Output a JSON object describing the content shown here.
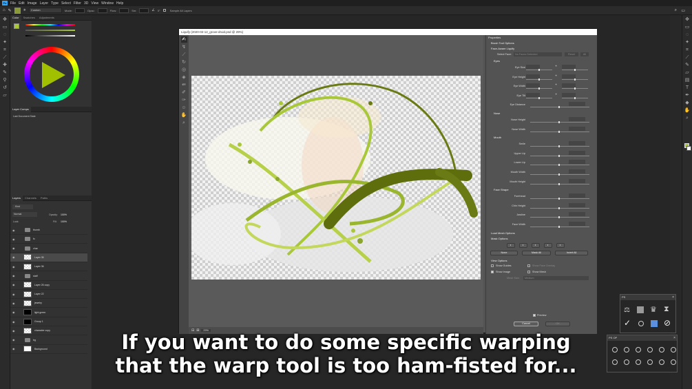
{
  "app": {
    "menu": [
      "File",
      "Edit",
      "Image",
      "Layer",
      "Type",
      "Select",
      "Filter",
      "3D",
      "View",
      "Window",
      "Help"
    ],
    "options": {
      "brush_preset": "Custom",
      "mode_label": "Mode:",
      "opacity_label": "Opac:",
      "flow_label": "Flow:",
      "smooth_label": "Sm:",
      "angle": "0°",
      "sample_all": "Sample All Layers"
    }
  },
  "left_panels": {
    "color_tabs": [
      "Color",
      "Swatches",
      "Adjustments"
    ],
    "layer_comps": {
      "tab": "Layer Comps",
      "item": "Last Document State"
    },
    "layers_tabs": [
      "Layers",
      "Channels",
      "Paths"
    ],
    "kind_label": "Kind",
    "blend_mode": "Normal",
    "opacity_label": "Opacity:",
    "opacity_value": "100%",
    "lock_label": "Lock:",
    "fill_label": "Fill:",
    "fill_value": "100%",
    "layers": [
      {
        "name": "thumb",
        "type": "folder"
      },
      {
        "name": "fx",
        "type": "folder"
      },
      {
        "name": "char",
        "type": "folder"
      },
      {
        "name": "Layer 35",
        "type": "layer",
        "selected": true
      },
      {
        "name": "Layer 36",
        "type": "layer"
      },
      {
        "name": "staff",
        "type": "folder"
      },
      {
        "name": "Layer 26 copy",
        "type": "layer"
      },
      {
        "name": "Layer 22",
        "type": "layer"
      },
      {
        "name": "jewelry",
        "type": "layer"
      },
      {
        "name": "light green",
        "type": "mask"
      },
      {
        "name": "Group 1",
        "type": "mask"
      },
      {
        "name": "character copy",
        "type": "layer"
      },
      {
        "name": "bg",
        "type": "folder"
      },
      {
        "name": "Background",
        "type": "bg"
      }
    ]
  },
  "dialog": {
    "title": "Liquify (2020-02-12_grove-druid.psd @ 29%)",
    "zoom": "29%",
    "properties": {
      "header": "Properties",
      "brush_tool_options": "Brush Tool Options",
      "face_aware": "Face-Aware Liquify",
      "select_face_label": "Select Face:",
      "select_face_value": "No Faces Detected",
      "reset": "Reset",
      "all": "All",
      "eyes": {
        "title": "Eyes",
        "rows": [
          "Eye Size",
          "Eye Height",
          "Eye Width",
          "Eye Tilt",
          "Eye Distance"
        ]
      },
      "nose": {
        "title": "Nose",
        "rows": [
          "Nose Height",
          "Nose Width"
        ]
      },
      "mouth": {
        "title": "Mouth",
        "rows": [
          "Smile",
          "Upper Lip",
          "Lower Lip",
          "Mouth Width",
          "Mouth Height"
        ]
      },
      "face_shape": {
        "title": "Face Shape",
        "rows": [
          "Forehead",
          "Chin Height",
          "Jawline",
          "Face Width"
        ]
      },
      "load_mesh": "Load Mesh Options",
      "mask_options": "Mask Options",
      "mask_buttons": [
        "None",
        "Mask All",
        "Invert All"
      ],
      "view_options": "View Options",
      "show_guides": "Show Guides",
      "show_face_overlay": "Show Face Overlay",
      "show_image": "Show Image",
      "show_mesh": "Show Mesh",
      "mesh_size_label": "Mesh Size:",
      "mesh_size_value": "Medium",
      "preview": "Preview",
      "cancel": "Cancel",
      "ok": "OK"
    }
  },
  "ps_panel": {
    "title": "PS"
  },
  "psop_panel": {
    "title": "PS OP"
  },
  "caption": {
    "line1": "If you want to do some specific warping",
    "line2": "that the warp tool is too ham-fisted for..."
  },
  "colors": {
    "accent": "#a8c83a",
    "stroke_dark": "#5a6a10",
    "ps_blue": "#31a8ff"
  }
}
